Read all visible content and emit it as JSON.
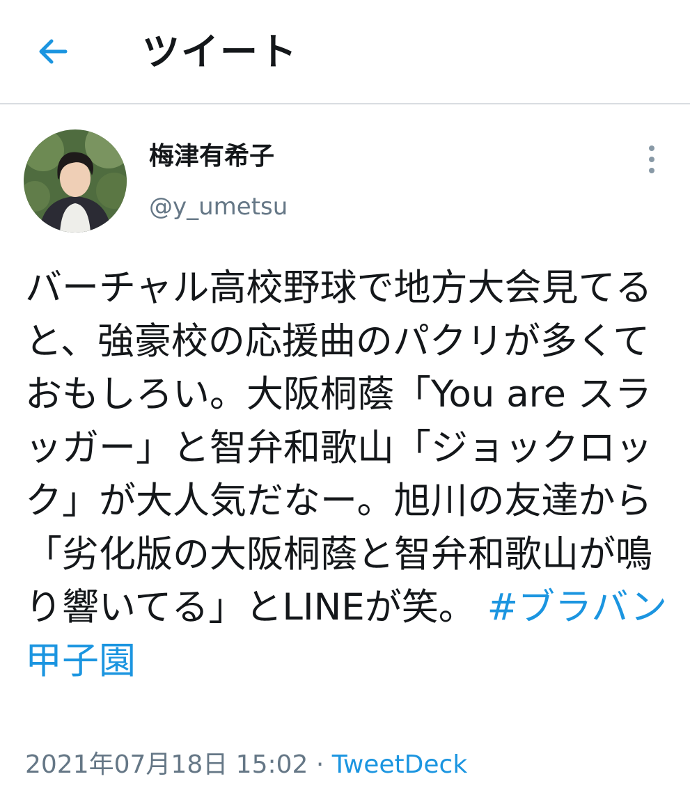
{
  "header": {
    "title": "ツイート",
    "back_icon": "arrow-left-icon"
  },
  "colors": {
    "accent": "#1b95e0",
    "text_primary": "#14171a",
    "text_secondary": "#657786",
    "divider": "#d9dde1"
  },
  "tweet": {
    "author_name": "梅津有希子",
    "author_handle": "@y_umetsu",
    "more_icon": "more-vertical-icon",
    "text": "バーチャル高校野球で地方大会見てると、強豪校の応援曲のパクリが多くておもしろい。大阪桐蔭「You are スラッガー」と智弁和歌山「ジョックロック」が大人気だなー。旭川の友達から「劣化版の大阪桐蔭と智弁和歌山が鳴り響いてる」とLINEが笑。",
    "hashtag": "#ブラバン甲子園",
    "timestamp": "2021年07月18日 15:02",
    "separator": " · ",
    "source": "TweetDeck"
  }
}
